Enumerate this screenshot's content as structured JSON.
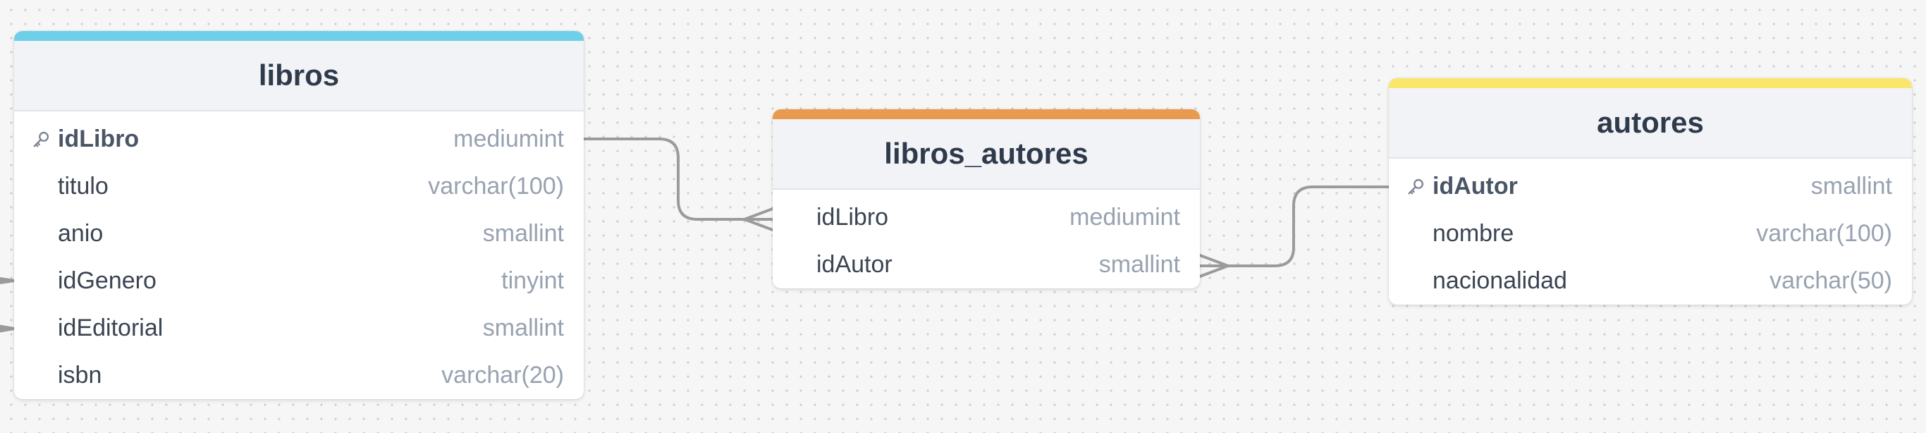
{
  "tables": {
    "libros": {
      "name": "libros",
      "color": "#6dd0e8",
      "fields": [
        {
          "name": "idLibro",
          "type": "mediumint",
          "pk": true
        },
        {
          "name": "titulo",
          "type": "varchar(100)"
        },
        {
          "name": "anio",
          "type": "smallint"
        },
        {
          "name": "idGenero",
          "type": "tinyint"
        },
        {
          "name": "idEditorial",
          "type": "smallint"
        },
        {
          "name": "isbn",
          "type": "varchar(20)"
        }
      ]
    },
    "libros_autores": {
      "name": "libros_autores",
      "color": "#e99a4e",
      "fields": [
        {
          "name": "idLibro",
          "type": "mediumint"
        },
        {
          "name": "idAutor",
          "type": "smallint"
        }
      ]
    },
    "autores": {
      "name": "autores",
      "color": "#fbe66c",
      "fields": [
        {
          "name": "idAutor",
          "type": "smallint",
          "pk": true
        },
        {
          "name": "nombre",
          "type": "varchar(100)"
        },
        {
          "name": "nacionalidad",
          "type": "varchar(50)"
        }
      ]
    }
  },
  "colors": {
    "canvas_background": "#f6f6f6",
    "connector": "#9b9b9b",
    "header_background": "#f1f3f7",
    "header_text": "#2f3a4a",
    "field_text": "#3b4452",
    "type_text": "#98a2b0"
  },
  "icons": {
    "primary_key": "key-icon",
    "relation_many_end": "crows-foot-icon"
  }
}
